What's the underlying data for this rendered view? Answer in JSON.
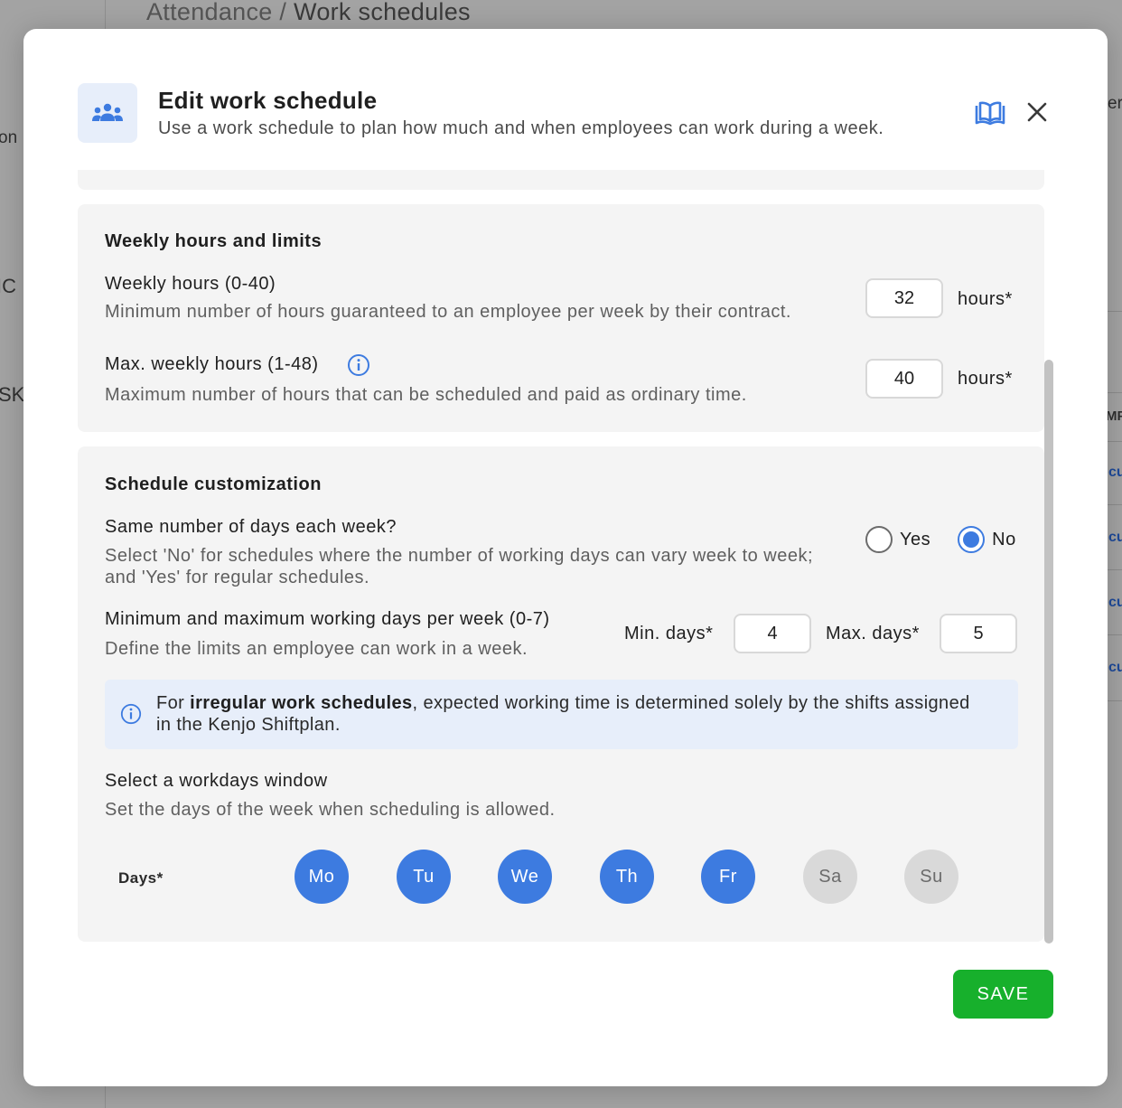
{
  "background": {
    "breadcrumb_parent": "Attendance /",
    "breadcrumb_current": "Work schedules",
    "frag_on": "on",
    "frag_ic": "IC",
    "frag_sk": "SK",
    "frag_er": "er",
    "frag_mp": "MP",
    "frag_cu": "cu"
  },
  "modal": {
    "title": "Edit work schedule",
    "subtitle": "Use a work schedule to plan how much and when employees can work during a week.",
    "icons": {
      "header": "people-group-icon",
      "guide": "open-book-icon",
      "close": "close-icon"
    },
    "weekly": {
      "section_title": "Weekly hours and limits",
      "weekly_hours_label": "Weekly hours (0-40)",
      "weekly_hours_help": "Minimum number of hours guaranteed to an employee per week by their contract.",
      "weekly_hours_value": "32",
      "weekly_hours_unit": "hours*",
      "max_hours_label": "Max. weekly hours (1-48)",
      "max_hours_help": "Maximum number of hours that can be scheduled and paid as ordinary time.",
      "max_hours_value": "40",
      "max_hours_unit": "hours*"
    },
    "customization": {
      "section_title": "Schedule customization",
      "same_days_label": "Same number of days each week?",
      "same_days_help": "Select 'No' for schedules where the number of working days can vary week to week; and 'Yes' for regular schedules.",
      "radio_yes": "Yes",
      "radio_no": "No",
      "selected": "No",
      "minmax_label": "Minimum and maximum working days per week (0-7)",
      "minmax_help": "Define the limits an employee can work in a week.",
      "min_days_label": "Min. days*",
      "min_days_value": "4",
      "max_days_label": "Max. days*",
      "max_days_value": "5",
      "banner_prefix": "For ",
      "banner_bold": "irregular work schedules",
      "banner_rest": ", expected working time is determined solely by the shifts assigned in the Kenjo Shiftplan.",
      "window_label": "Select a workdays window",
      "window_help": "Set the days of the week when scheduling is allowed.",
      "days_label": "Days*",
      "days": [
        {
          "label": "Mo",
          "selected": true
        },
        {
          "label": "Tu",
          "selected": true
        },
        {
          "label": "We",
          "selected": true
        },
        {
          "label": "Th",
          "selected": true
        },
        {
          "label": "Fr",
          "selected": true
        },
        {
          "label": "Sa",
          "selected": false
        },
        {
          "label": "Su",
          "selected": false
        }
      ]
    },
    "save_label": "SAVE",
    "colors": {
      "accent": "#3d7be0",
      "save": "#17b02c",
      "info_bg": "#e7eefa",
      "card_bg": "#f4f4f4"
    }
  }
}
